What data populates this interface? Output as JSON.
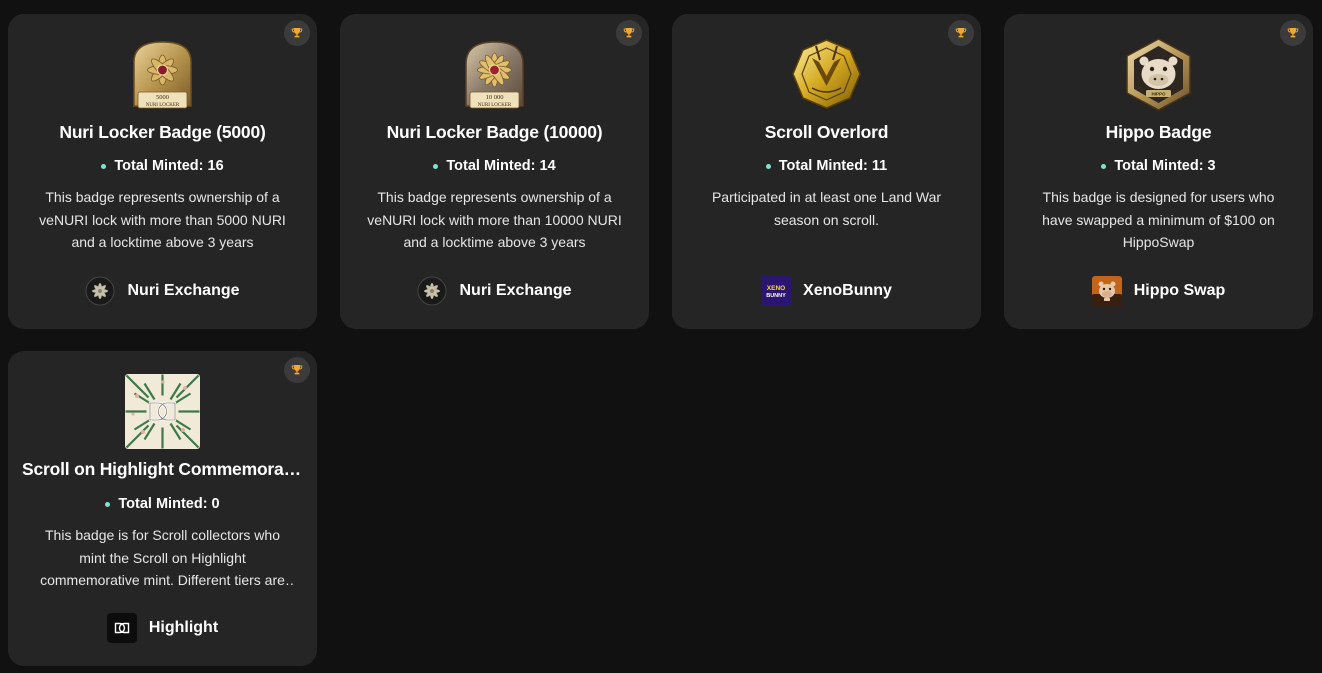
{
  "minted_label": "Total Minted:",
  "accent_dot_color": "#7fe3d3",
  "badges": [
    {
      "title": "Nuri Locker Badge (5000)",
      "minted": "16",
      "description": "This badge represents ownership of a veNURI lock with more than 5000 NURI and a locktime above 3 years",
      "image_text": "5000\nNURI LOCKER",
      "issuer": "Nuri Exchange",
      "issuer_icon": "nuri-flower-icon"
    },
    {
      "title": "Nuri Locker Badge (10000)",
      "minted": "14",
      "description": "This badge represents ownership of a veNURI lock with more than 10000 NURI and a locktime above 3 years",
      "image_text": "10 000\nNURI LOCKER",
      "issuer": "Nuri Exchange",
      "issuer_icon": "nuri-flower-icon"
    },
    {
      "title": "Scroll Overlord",
      "minted": "11",
      "description": "Participated in at least one Land War season on scroll.",
      "issuer": "XenoBunny",
      "issuer_logo_text": "XENO BUNNY",
      "issuer_icon": "xenobunny-logo-icon"
    },
    {
      "title": "Hippo Badge",
      "minted": "3",
      "description": "This badge is designed for users who have swapped a minimum of $100 on HippoSwap",
      "image_text": "HIPPO",
      "issuer": "Hippo Swap",
      "issuer_icon": "hippo-logo-icon"
    },
    {
      "title": "Scroll on Highlight Commemorative Mint",
      "minted": "0",
      "description": "This badge is for Scroll collectors who mint the Scroll on Highlight commemorative mint. Different tiers are available",
      "issuer": "Highlight",
      "issuer_icon": "highlight-logo-icon"
    }
  ]
}
